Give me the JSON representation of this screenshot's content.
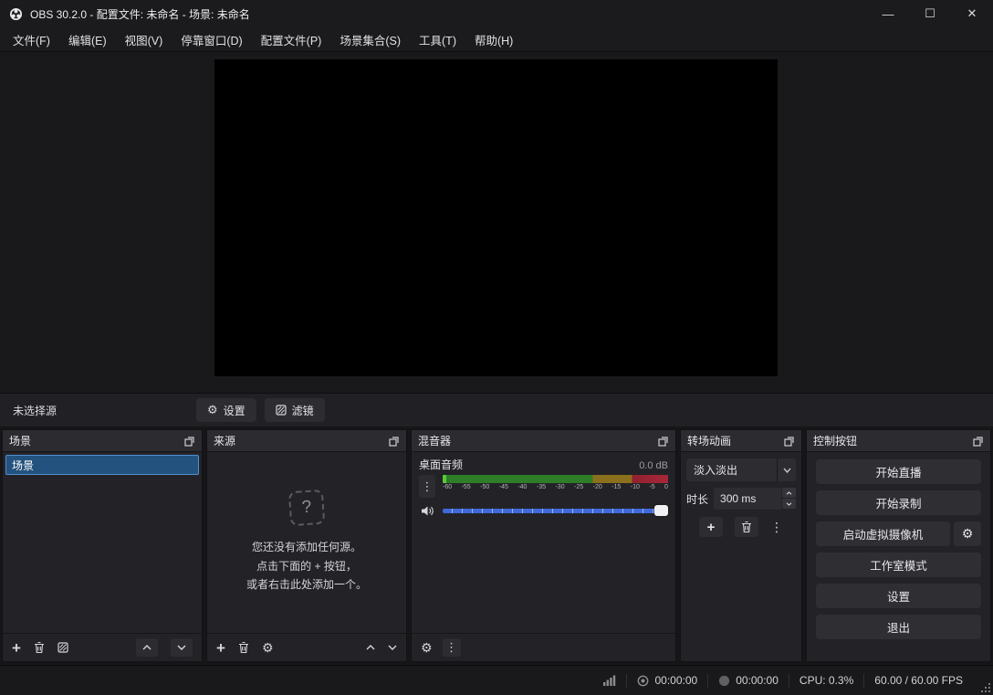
{
  "window": {
    "title": "OBS 30.2.0 - 配置文件: 未命名 - 场景: 未命名",
    "controls": {
      "minimize": "—",
      "maximize": "☐",
      "close": "✕"
    }
  },
  "menu": {
    "items": [
      "文件(F)",
      "编辑(E)",
      "视图(V)",
      "停靠窗口(D)",
      "配置文件(P)",
      "场景集合(S)",
      "工具(T)",
      "帮助(H)"
    ]
  },
  "source_toolbar": {
    "no_source": "未选择源",
    "settings": "设置",
    "filters": "滤镜"
  },
  "docks": {
    "scenes": {
      "title": "场景",
      "items": [
        {
          "label": "场景",
          "selected": true
        }
      ]
    },
    "sources": {
      "title": "来源",
      "placeholder_icon": "?",
      "empty": [
        "您还没有添加任何源。",
        "点击下面的 + 按钮，",
        "或者右击此处添加一个。"
      ]
    },
    "mixer": {
      "title": "混音器",
      "channel": "桌面音频",
      "level": "0.0 dB",
      "scale": [
        "-60",
        "-55",
        "-50",
        "-45",
        "-40",
        "-35",
        "-30",
        "-25",
        "-20",
        "-15",
        "-10",
        "-5",
        "0"
      ]
    },
    "transitions": {
      "title": "转场动画",
      "transition": "淡入淡出",
      "duration_label": "时长",
      "duration_value": "300 ms"
    },
    "controls": {
      "title": "控制按钮",
      "buttons": [
        "开始直播",
        "开始录制",
        "启动虚拟摄像机",
        "工作室模式",
        "设置",
        "退出"
      ]
    }
  },
  "statusbar": {
    "stream_time": "00:00:00",
    "rec_time": "00:00:00",
    "cpu": "CPU: 0.3%",
    "fps": "60.00 / 60.00 FPS"
  },
  "icons": {
    "plus": "+",
    "dots": "⋮",
    "gear": "⚙"
  },
  "colors": {
    "accent_blue": "#3f68d9",
    "selection_fill": "#24527e",
    "selection_border": "#4f8fd0",
    "meter_green": "#2f7d27",
    "meter_yellow": "#8a701c",
    "meter_red": "#a82738",
    "panel_bg": "#232327",
    "panel_header_bg": "#2b2b30"
  }
}
